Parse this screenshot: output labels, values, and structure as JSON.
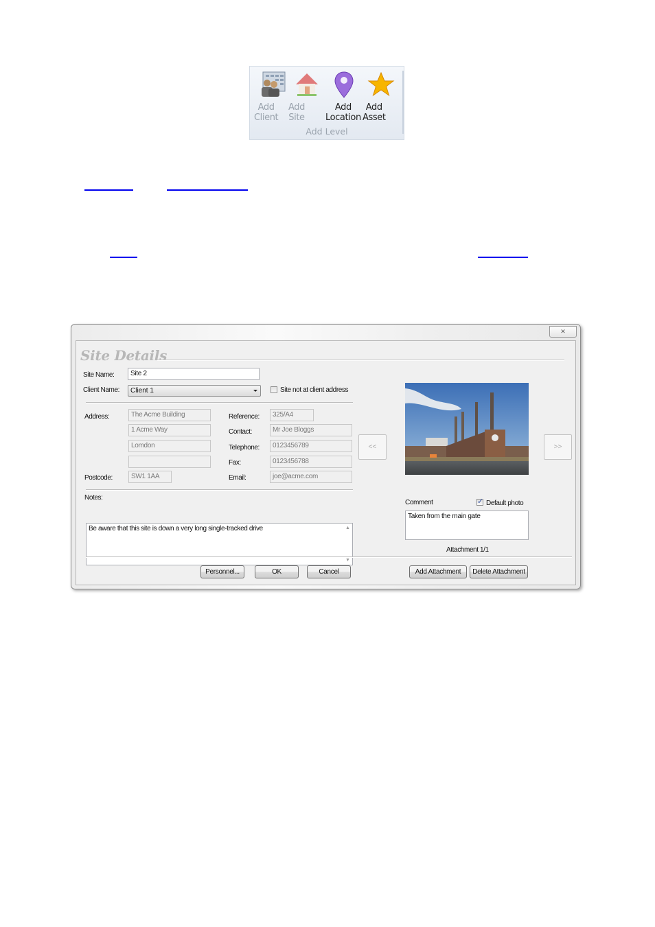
{
  "ribbon": {
    "group_label": "Add Level",
    "buttons": [
      {
        "line1": "Add",
        "line2": "Client",
        "icon": "client-card-icon",
        "enabled": false
      },
      {
        "line1": "Add",
        "line2": "Site",
        "icon": "house-icon",
        "enabled": false
      },
      {
        "line1": "Add",
        "line2": "Location",
        "icon": "map-pin-icon",
        "enabled": true
      },
      {
        "line1": "Add",
        "line2": "Asset",
        "icon": "star-icon",
        "enabled": true
      }
    ]
  },
  "dialog": {
    "close_glyph": "✕",
    "title": "Site Details",
    "site_name": {
      "label": "Site Name:",
      "value": "Site 2"
    },
    "client_name": {
      "label": "Client Name:",
      "value": "Client 1"
    },
    "site_not_at_client": {
      "label": "Site not at client address",
      "checked": false
    },
    "address": {
      "label": "Address:",
      "lines": [
        "The Acme Building",
        "1 Acme Way",
        "Lomdon",
        ""
      ]
    },
    "postcode": {
      "label": "Postcode:",
      "value": "SW1 1AA"
    },
    "reference": {
      "label": "Reference:",
      "value": "325/A4"
    },
    "contact": {
      "label": "Contact:",
      "value": "Mr Joe Bloggs"
    },
    "telephone": {
      "label": "Telephone:",
      "value": "0123456789"
    },
    "fax": {
      "label": "Fax:",
      "value": "0123456788"
    },
    "email": {
      "label": "Email:",
      "value": "joe@acme.com"
    },
    "notes": {
      "label": "Notes:",
      "value": "Be aware that this site is down a very long single-tracked drive"
    },
    "prev_label": "<<",
    "next_label": ">>",
    "comment": {
      "label": "Comment",
      "value": "Taken from the main gate"
    },
    "default_photo": {
      "label": "Default photo",
      "checked": true
    },
    "attachment_counter": "Attachment 1/1",
    "buttons": {
      "personnel": "Personnel...",
      "ok": "OK",
      "cancel": "Cancel",
      "add_attachment": "Add Attachment",
      "delete_attachment": "Delete Attachment"
    }
  }
}
